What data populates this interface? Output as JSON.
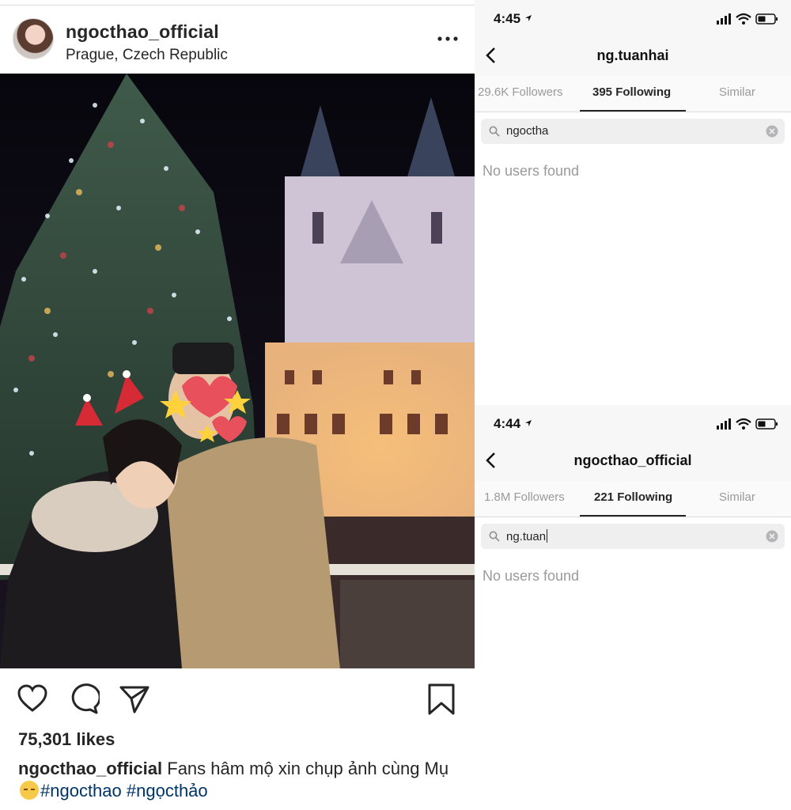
{
  "post": {
    "username": "ngocthao_official",
    "location": "Prague, Czech Republic",
    "likes": "75,301 likes",
    "caption_user": "ngocthao_official",
    "caption_text": "Fans hâm mộ xin chụp ảnh cùng Mụ",
    "hashtag_1": "#ngocthao",
    "hashtag_2": "#ngọcthảo",
    "icons": [
      "more-icon",
      "heart-icon",
      "comment-icon",
      "share-icon",
      "bookmark-icon"
    ]
  },
  "screen_top": {
    "time": "4:45",
    "title": "ng.tuanhai",
    "tabs": [
      "29.6K Followers",
      "395 Following",
      "Similar"
    ],
    "active_tab": 1,
    "search_value": "ngoctha",
    "empty_message": "No users found"
  },
  "screen_bottom": {
    "time": "4:44",
    "title": "ngocthao_official",
    "tabs": [
      "1.8M Followers",
      "221 Following",
      "Similar"
    ],
    "active_tab": 1,
    "search_value": "ng.tuan",
    "empty_message": "No users found"
  },
  "colors": {
    "text": "#262626",
    "muted": "#9a9a9a",
    "hashtag": "#003569",
    "bar_background": "#f7f7f7"
  }
}
